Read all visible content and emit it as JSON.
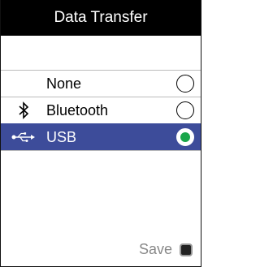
{
  "header": {
    "title": "Data Transfer"
  },
  "options": [
    {
      "label": "None",
      "icon": "none",
      "selected": false
    },
    {
      "label": "Bluetooth",
      "icon": "bluetooth-icon",
      "selected": false
    },
    {
      "label": "USB",
      "icon": "usb-icon",
      "selected": true
    }
  ],
  "footer": {
    "save_label": "Save",
    "save_icon": "softkey-icon"
  },
  "colors": {
    "title_bg": "#000000",
    "selected_bg": "#3d4c9a",
    "radio_selected": "#1aa64a",
    "footer_text": "#888888"
  }
}
